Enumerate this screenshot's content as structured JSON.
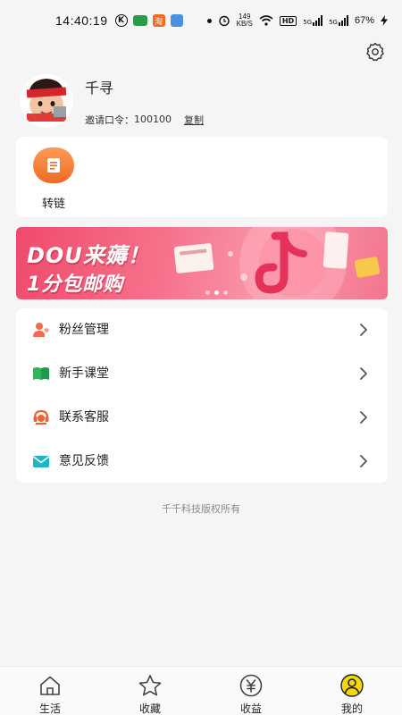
{
  "status_bar": {
    "time": "14:40:19",
    "k_icon": "K",
    "tao_icon": "淘",
    "speed_value": "149",
    "speed_unit": "KB/S",
    "hd": "HD",
    "net1": "5G",
    "net2": "5G",
    "battery": "67%"
  },
  "profile": {
    "username": "千寻",
    "invite_label": "邀请口令：",
    "invite_code": "100100",
    "copy_label": "复制"
  },
  "tools": [
    {
      "label": "转链",
      "icon": "link-convert-icon"
    }
  ],
  "banner": {
    "line1": "DOU来薅！",
    "line2": "1分包邮购",
    "dots": 3,
    "active_dot": 1
  },
  "menu": [
    {
      "label": "粉丝管理",
      "icon": "fans-icon"
    },
    {
      "label": "新手课堂",
      "icon": "book-icon"
    },
    {
      "label": "联系客服",
      "icon": "customer-service-icon"
    },
    {
      "label": "意见反馈",
      "icon": "feedback-mail-icon"
    }
  ],
  "copyright": "千千科技版权所有",
  "tabs": [
    {
      "label": "生活",
      "icon": "home-icon"
    },
    {
      "label": "收藏",
      "icon": "star-icon"
    },
    {
      "label": "收益",
      "icon": "yuan-icon"
    },
    {
      "label": "我的",
      "icon": "user-icon",
      "active": true
    }
  ],
  "colors": {
    "accent_orange": "#ee6b24",
    "menu_fans": "#f26b4f",
    "menu_book": "#2cb65d",
    "menu_service": "#f0622f",
    "menu_feedback": "#1fb5c8",
    "tab_active": "#f5d90a"
  }
}
